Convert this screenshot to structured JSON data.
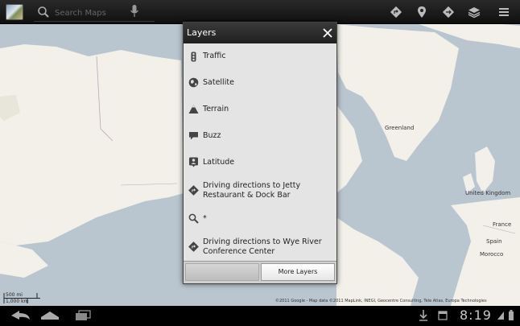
{
  "search": {
    "placeholder": "Search Maps"
  },
  "map": {
    "places": [
      "Greenland",
      "United Kingdom",
      "France",
      "Morocco",
      "Spain"
    ]
  },
  "scale": {
    "top_label": "500 mi",
    "bottom_label": "1,000 km"
  },
  "copyright": "©2011 Google - Map data ©2011 MapLink, INEGI, Geocentre Consulting, Tele Atlas, Europa Technologies",
  "dialog": {
    "title": "Layers",
    "items": [
      {
        "label": "Traffic",
        "icon": "traffic-icon"
      },
      {
        "label": "Satellite",
        "icon": "globe-icon"
      },
      {
        "label": "Terrain",
        "icon": "terrain-icon"
      },
      {
        "label": "Buzz",
        "icon": "buzz-icon"
      },
      {
        "label": "Latitude",
        "icon": "latitude-icon"
      },
      {
        "label": "Driving directions to Jetty Restaurant & Dock Bar",
        "icon": "directions-icon"
      },
      {
        "label": "*",
        "icon": "search-icon"
      },
      {
        "label": "Driving directions to Wye River Conference Center",
        "icon": "directions-icon"
      }
    ],
    "more_layers": "More Layers"
  },
  "status": {
    "time": "8:19"
  },
  "colors": {
    "water": "#b9c5cf",
    "land": "#f2f0e9",
    "accent": "#33b5e5"
  }
}
